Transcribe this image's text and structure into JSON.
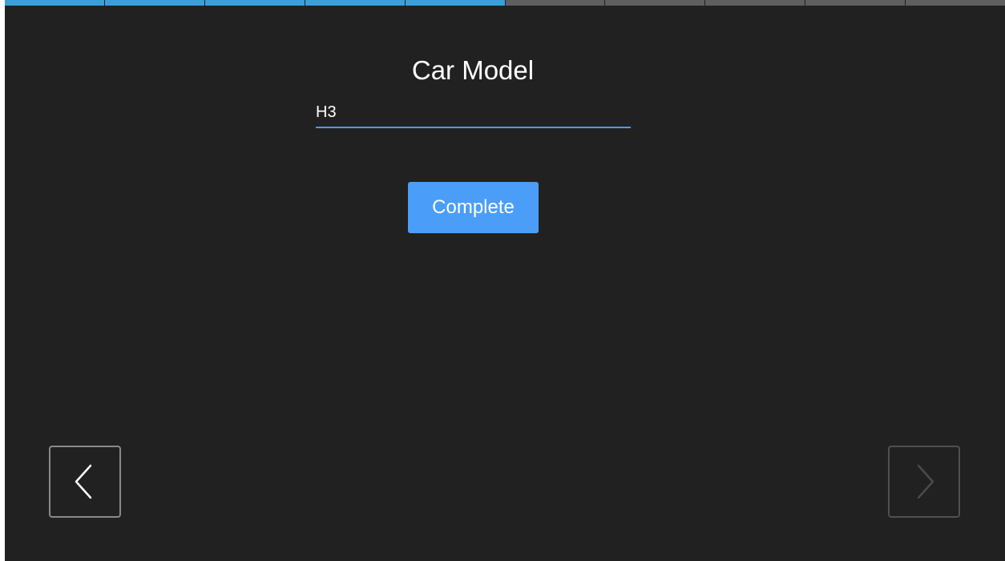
{
  "progress": {
    "total_steps": 10,
    "completed_steps": 5,
    "active_color": "#3aa0dc",
    "inactive_color": "#5f5f5f"
  },
  "form": {
    "title": "Car Model",
    "car_model_value": "H3",
    "underline_color": "#4a9bf0"
  },
  "actions": {
    "complete_label": "Complete",
    "complete_color": "#4b9ef8"
  },
  "navigation": {
    "prev_icon": "chevron-left-icon",
    "next_icon": "chevron-right-icon",
    "next_enabled": false
  },
  "theme": {
    "background": "#212121"
  }
}
